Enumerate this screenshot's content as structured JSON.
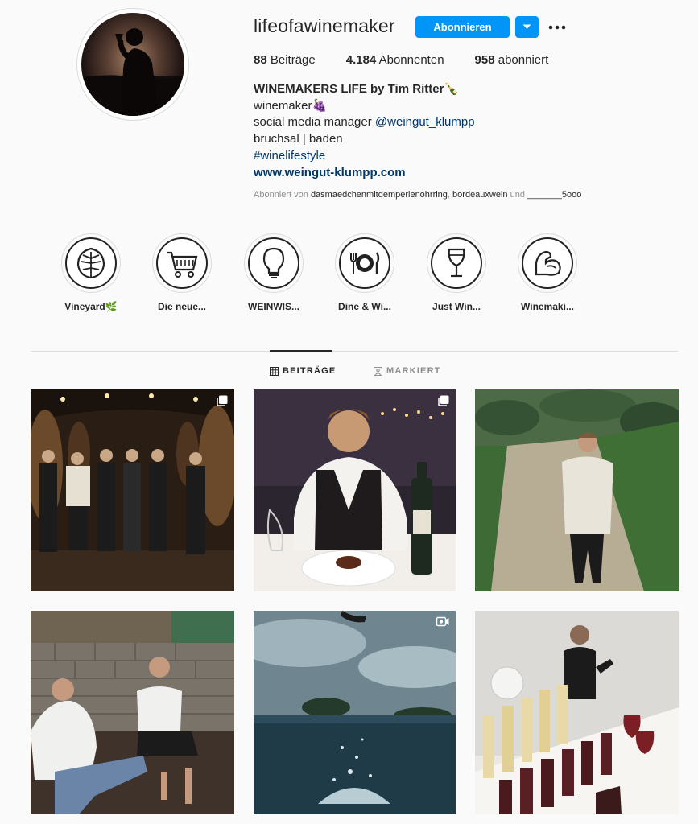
{
  "profile": {
    "username": "lifeofawinemaker",
    "follow_label": "Abonnieren",
    "stats": {
      "posts_count": "88",
      "posts_label": " Beiträge",
      "followers_count": "4.184",
      "followers_label": " Abonnenten",
      "following_count": "958",
      "following_label": " abonniert"
    },
    "bio": {
      "full_name": "WINEMAKERS LIFE by Tim Ritter🍾",
      "line1": "winemaker🍇",
      "line2_prefix": "social media manager ",
      "line2_mention": "@weingut_klumpp",
      "line3": "bruchsal | baden",
      "hashtag": "#winelifestyle",
      "website": "www.weingut-klumpp.com"
    },
    "followed_by": {
      "prefix": "Abonniert von ",
      "user1": "dasmaedchenmitdemperlenohrring",
      "sep": ", ",
      "user2": "bordeauxwein",
      "and": " und ",
      "user3": "_______5ooo"
    }
  },
  "highlights": [
    {
      "label": "Vineyard🌿",
      "icon": "leaf-icon"
    },
    {
      "label": "Die neue...",
      "icon": "shopping-cart-icon"
    },
    {
      "label": "WEINWIS...",
      "icon": "lightbulb-icon"
    },
    {
      "label": "Dine & Wi...",
      "icon": "plate-cutlery-icon"
    },
    {
      "label": "Just Win...",
      "icon": "wine-glass-icon"
    },
    {
      "label": "Winemaki...",
      "icon": "flexed-arm-icon"
    }
  ],
  "tabs": {
    "posts": "BEITRÄGE",
    "tagged": "MARKIERT"
  },
  "posts": [
    {
      "name": "post-cellar-group",
      "badge": "carousel-icon"
    },
    {
      "name": "post-dinner-wine",
      "badge": "carousel-icon"
    },
    {
      "name": "post-vineyard-path",
      "badge": ""
    },
    {
      "name": "post-terrace-friends",
      "badge": ""
    },
    {
      "name": "post-pool-splash",
      "badge": "video-icon"
    },
    {
      "name": "post-wine-tasting",
      "badge": ""
    }
  ],
  "colors": {
    "accent": "#0095f6",
    "link": "#00376b",
    "muted": "#8e8e8e",
    "text": "#262626"
  }
}
